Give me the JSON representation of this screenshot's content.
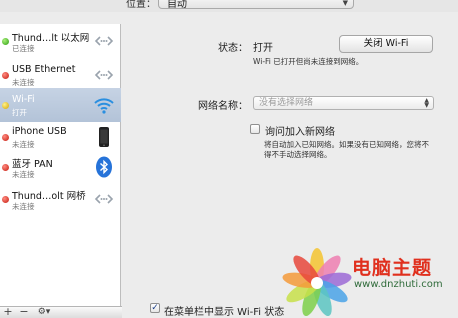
{
  "location": {
    "label": "位置：",
    "value": "自动"
  },
  "services": [
    {
      "name": "Thund…lt 以太网",
      "status": "已连接",
      "status_color": "green",
      "icon": "arrows-icon"
    },
    {
      "name": "USB Ethernet",
      "status": "未连接",
      "status_color": "red",
      "icon": "arrows-icon"
    },
    {
      "name": "Wi-Fi",
      "status": "打开",
      "status_color": "yellow",
      "icon": "wifi-icon",
      "selected": true
    },
    {
      "name": "iPhone USB",
      "status": "未连接",
      "status_color": "red",
      "icon": "iphone-icon"
    },
    {
      "name": "蓝牙 PAN",
      "status": "未连接",
      "status_color": "red",
      "icon": "bluetooth-icon"
    },
    {
      "name": "Thund…olt 网桥",
      "status": "未连接",
      "status_color": "red",
      "icon": "arrows-icon"
    }
  ],
  "sidebar_buttons": {
    "add": "+",
    "remove": "−",
    "action": "⚙▾"
  },
  "status": {
    "label": "状态：",
    "value": "打开",
    "toggle_button": "关闭 Wi-Fi",
    "description": "Wi-Fi 已打开但尚未连接到网络。"
  },
  "network_name": {
    "label": "网络名称：",
    "placeholder": "没有选择网络"
  },
  "ask_join": {
    "label": "询问加入新网络",
    "checked": false,
    "help": [
      "将自动加入已知网络。如果没有已知网络，您将不",
      "得不手动选择网络。"
    ]
  },
  "show_menu_bar": {
    "label": "在菜单栏中显示 Wi-Fi 状态",
    "checked": true
  },
  "watermark": {
    "title": "电脑主题",
    "url": "www.dnzhuti.com"
  },
  "colors": {
    "selected_row": "#b3c3d8",
    "status_green": "#2c9b10",
    "status_red": "#c41a0f",
    "status_yellow": "#d3a300",
    "wifi_blue": "#2a8fe0",
    "watermark_red": "#e0301e"
  }
}
